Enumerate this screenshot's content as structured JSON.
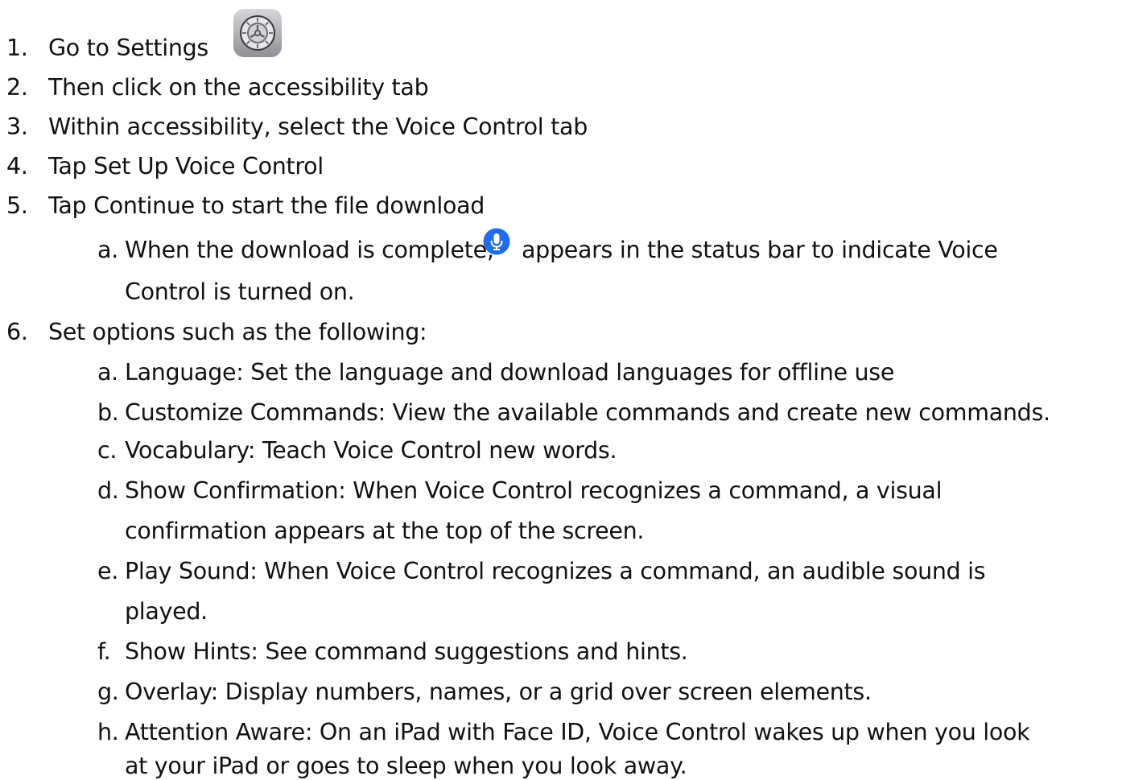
{
  "steps": [
    {
      "marker": "1.",
      "text": "Go to Settings"
    },
    {
      "marker": "2.",
      "text": "Then click on the accessibility tab"
    },
    {
      "marker": "3.",
      "text": "Within accessibility, select the Voice Control tab"
    },
    {
      "marker": "4.",
      "text": "Tap Set Up Voice Control"
    },
    {
      "marker": "5.",
      "text": "Tap Continue to start the file download"
    },
    {
      "marker": "6.",
      "text": "Set options such as the following:"
    }
  ],
  "step5_sub": {
    "marker": "a.",
    "text_before_icon": "When the download is complete,",
    "text_after_icon": "appears in the status bar to indicate Voice",
    "text_continuation": "Control is turned on."
  },
  "step6_sub": [
    {
      "marker": "a.",
      "lines": [
        "Language: Set the language and download languages for offline use"
      ]
    },
    {
      "marker": "b.",
      "lines": [
        "Customize Commands: View the available commands and create new commands."
      ]
    },
    {
      "marker": "c.",
      "lines": [
        "Vocabulary: Teach Voice Control new words."
      ]
    },
    {
      "marker": "d.",
      "lines": [
        "Show Confirmation: When Voice Control recognizes a command, a visual",
        "confirmation appears at the top of the screen."
      ]
    },
    {
      "marker": "e.",
      "lines": [
        "Play Sound: When Voice Control recognizes a command, an audible sound is",
        "played."
      ]
    },
    {
      "marker": "f.",
      "lines": [
        "Show Hints: See command suggestions and hints."
      ]
    },
    {
      "marker": "g.",
      "lines": [
        "Overlay: Display numbers, names, or a grid over screen elements."
      ]
    },
    {
      "marker": "h.",
      "lines": [
        "Attention Aware: On an iPad with Face ID, Voice Control wakes up when you look",
        "at your iPad or goes to sleep when you look away."
      ]
    }
  ],
  "icons": {
    "settings": "settings-gear-icon",
    "microphone": "microphone-icon"
  },
  "colors": {
    "text": "#111111",
    "mic_blue": "#1f6cf0",
    "settings_gray": "#8e8e93"
  }
}
